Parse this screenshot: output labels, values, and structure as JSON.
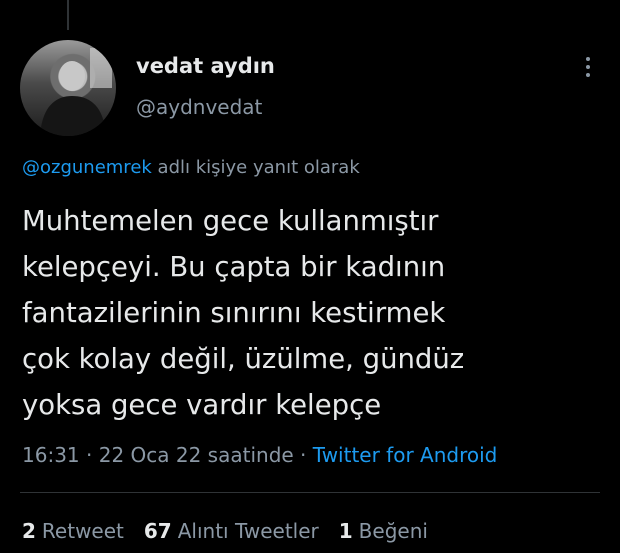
{
  "author": {
    "display_name": "vedat aydın",
    "handle": "@aydnvedat"
  },
  "reply_context": {
    "mention": "@ozgunemrek",
    "suffix": " adlı kişiye yanıt olarak"
  },
  "tweet": {
    "lines": [
      "Muhtemelen gece kullanmıştır",
      "kelepçeyi. Bu çapta bir kadının",
      "fantazilerinin sınırını kestirmek",
      "çok kolay değil, üzülme, gündüz",
      "yoksa gece vardır kelepçe"
    ]
  },
  "meta": {
    "time": "16:31",
    "separator": " · ",
    "date": "22 Oca 22 saatinde",
    "source": "Twitter for Android"
  },
  "stats": {
    "retweets_count": "2",
    "retweets_label": "Retweet",
    "quotes_count": "67",
    "quotes_label": "Alıntı Tweetler",
    "likes_count": "1",
    "likes_label": "Beğeni"
  },
  "colors": {
    "background": "#000000",
    "text": "#e7e9ea",
    "secondary": "#8b98a5",
    "accent": "#1d9bf0"
  },
  "icons": {
    "more": "more-vertical-icon"
  }
}
